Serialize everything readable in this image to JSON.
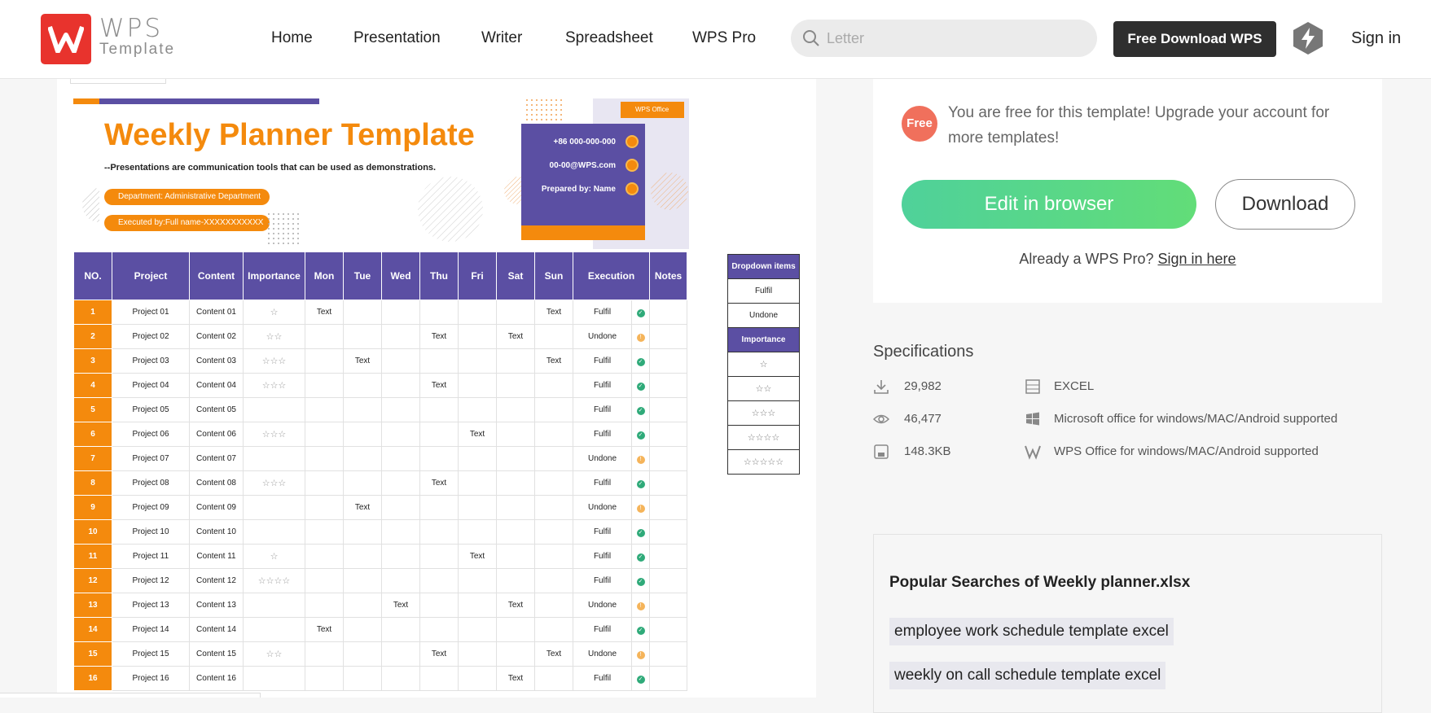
{
  "header": {
    "logo_text": "WPS",
    "logo_sub": "Template",
    "nav": [
      "Home",
      "Presentation",
      "Writer",
      "Spreadsheet",
      "WPS Pro"
    ],
    "search_placeholder": "Letter",
    "download_label": "Free Download WPS",
    "signin_label": "Sign in"
  },
  "preview": {
    "title": "Weekly Planner Template",
    "subtitle": "--Presentations are communication tools that can be used as demonstrations.",
    "department": "Department: Administrative Department",
    "executed_by": "Executed by:Full name-XXXXXXXXXXX",
    "phone": "+86 000-000-000",
    "email": "00-00@WPS.com",
    "prepared_by": "Prepared by: Name",
    "badge": "WPS Office",
    "columns": [
      "NO.",
      "Project",
      "Content",
      "Importance",
      "Mon",
      "Tue",
      "Wed",
      "Thu",
      "Fri",
      "Sat",
      "Sun",
      "Execution",
      "Notes"
    ],
    "rows": [
      {
        "no": "1",
        "project": "Project 01",
        "content": "Content 01",
        "importance": "☆",
        "mon": "Text",
        "tue": "",
        "wed": "",
        "thu": "",
        "fri": "",
        "sat": "",
        "sun": "Text",
        "exec": "Fulfil",
        "status": "ok"
      },
      {
        "no": "2",
        "project": "Project 02",
        "content": "Content 02",
        "importance": "☆☆",
        "mon": "",
        "tue": "",
        "wed": "",
        "thu": "Text",
        "fri": "",
        "sat": "Text",
        "sun": "",
        "exec": "Undone",
        "status": "warn"
      },
      {
        "no": "3",
        "project": "Project 03",
        "content": "Content 03",
        "importance": "☆☆☆",
        "mon": "",
        "tue": "Text",
        "wed": "",
        "thu": "",
        "fri": "",
        "sat": "",
        "sun": "Text",
        "exec": "Fulfil",
        "status": "ok"
      },
      {
        "no": "4",
        "project": "Project 04",
        "content": "Content 04",
        "importance": "☆☆☆",
        "mon": "",
        "tue": "",
        "wed": "",
        "thu": "Text",
        "fri": "",
        "sat": "",
        "sun": "",
        "exec": "Fulfil",
        "status": "ok"
      },
      {
        "no": "5",
        "project": "Project 05",
        "content": "Content 05",
        "importance": "",
        "mon": "",
        "tue": "",
        "wed": "",
        "thu": "",
        "fri": "",
        "sat": "",
        "sun": "",
        "exec": "Fulfil",
        "status": "ok"
      },
      {
        "no": "6",
        "project": "Project 06",
        "content": "Content 06",
        "importance": "☆☆☆",
        "mon": "",
        "tue": "",
        "wed": "",
        "thu": "",
        "fri": "Text",
        "sat": "",
        "sun": "",
        "exec": "Fulfil",
        "status": "ok"
      },
      {
        "no": "7",
        "project": "Project 07",
        "content": "Content 07",
        "importance": "",
        "mon": "",
        "tue": "",
        "wed": "",
        "thu": "",
        "fri": "",
        "sat": "",
        "sun": "",
        "exec": "Undone",
        "status": "warn"
      },
      {
        "no": "8",
        "project": "Project 08",
        "content": "Content 08",
        "importance": "☆☆☆",
        "mon": "",
        "tue": "",
        "wed": "",
        "thu": "Text",
        "fri": "",
        "sat": "",
        "sun": "",
        "exec": "Fulfil",
        "status": "ok"
      },
      {
        "no": "9",
        "project": "Project 09",
        "content": "Content 09",
        "importance": "",
        "mon": "",
        "tue": "Text",
        "wed": "",
        "thu": "",
        "fri": "",
        "sat": "",
        "sun": "",
        "exec": "Undone",
        "status": "warn"
      },
      {
        "no": "10",
        "project": "Project 10",
        "content": "Content 10",
        "importance": "",
        "mon": "",
        "tue": "",
        "wed": "",
        "thu": "",
        "fri": "",
        "sat": "",
        "sun": "",
        "exec": "Fulfil",
        "status": "ok"
      },
      {
        "no": "11",
        "project": "Project 11",
        "content": "Content 11",
        "importance": "☆",
        "mon": "",
        "tue": "",
        "wed": "",
        "thu": "",
        "fri": "Text",
        "sat": "",
        "sun": "",
        "exec": "Fulfil",
        "status": "ok"
      },
      {
        "no": "12",
        "project": "Project 12",
        "content": "Content 12",
        "importance": "☆☆☆☆",
        "mon": "",
        "tue": "",
        "wed": "",
        "thu": "",
        "fri": "",
        "sat": "",
        "sun": "",
        "exec": "Fulfil",
        "status": "ok"
      },
      {
        "no": "13",
        "project": "Project 13",
        "content": "Content 13",
        "importance": "",
        "mon": "",
        "tue": "",
        "wed": "Text",
        "thu": "",
        "fri": "",
        "sat": "Text",
        "sun": "",
        "exec": "Undone",
        "status": "warn"
      },
      {
        "no": "14",
        "project": "Project 14",
        "content": "Content 14",
        "importance": "",
        "mon": "Text",
        "tue": "",
        "wed": "",
        "thu": "",
        "fri": "",
        "sat": "",
        "sun": "",
        "exec": "Fulfil",
        "status": "ok"
      },
      {
        "no": "15",
        "project": "Project 15",
        "content": "Content 15",
        "importance": "☆☆",
        "mon": "",
        "tue": "",
        "wed": "",
        "thu": "Text",
        "fri": "",
        "sat": "",
        "sun": "Text",
        "exec": "Undone",
        "status": "warn"
      },
      {
        "no": "16",
        "project": "Project 16",
        "content": "Content 16",
        "importance": "",
        "mon": "",
        "tue": "",
        "wed": "",
        "thu": "",
        "fri": "",
        "sat": "Text",
        "sun": "",
        "exec": "Fulfil",
        "status": "ok"
      }
    ],
    "dropdown": {
      "header": "Dropdown items",
      "items": [
        "Fulfil",
        "Undone"
      ],
      "importance_header": "Importance",
      "importance_items": [
        "☆",
        "☆☆",
        "☆☆☆",
        "☆☆☆☆",
        "☆☆☆☆☆"
      ]
    }
  },
  "card": {
    "free_badge": "Free",
    "free_text": "You are free for this template! Upgrade your account for more templates!",
    "edit_label": "Edit in browser",
    "download_label": "Download",
    "already_text": "Already a WPS Pro?",
    "signin_here": "Sign in here"
  },
  "specs": {
    "title": "Specifications",
    "downloads": "29,982",
    "views": "46,477",
    "size": "148.3KB",
    "format": "EXCEL",
    "ms_support": "Microsoft office for windows/MAC/Android supported",
    "wps_support": "WPS Office for windows/MAC/Android supported"
  },
  "popular": {
    "title": "Popular Searches of Weekly planner.xlsx",
    "tags": [
      "employee work schedule template excel",
      "weekly on call schedule template excel"
    ]
  },
  "colors": {
    "brand_red": "#e8332d",
    "orange": "#f48a0d",
    "purple": "#5b4fa3",
    "green": "#5ad67f"
  }
}
